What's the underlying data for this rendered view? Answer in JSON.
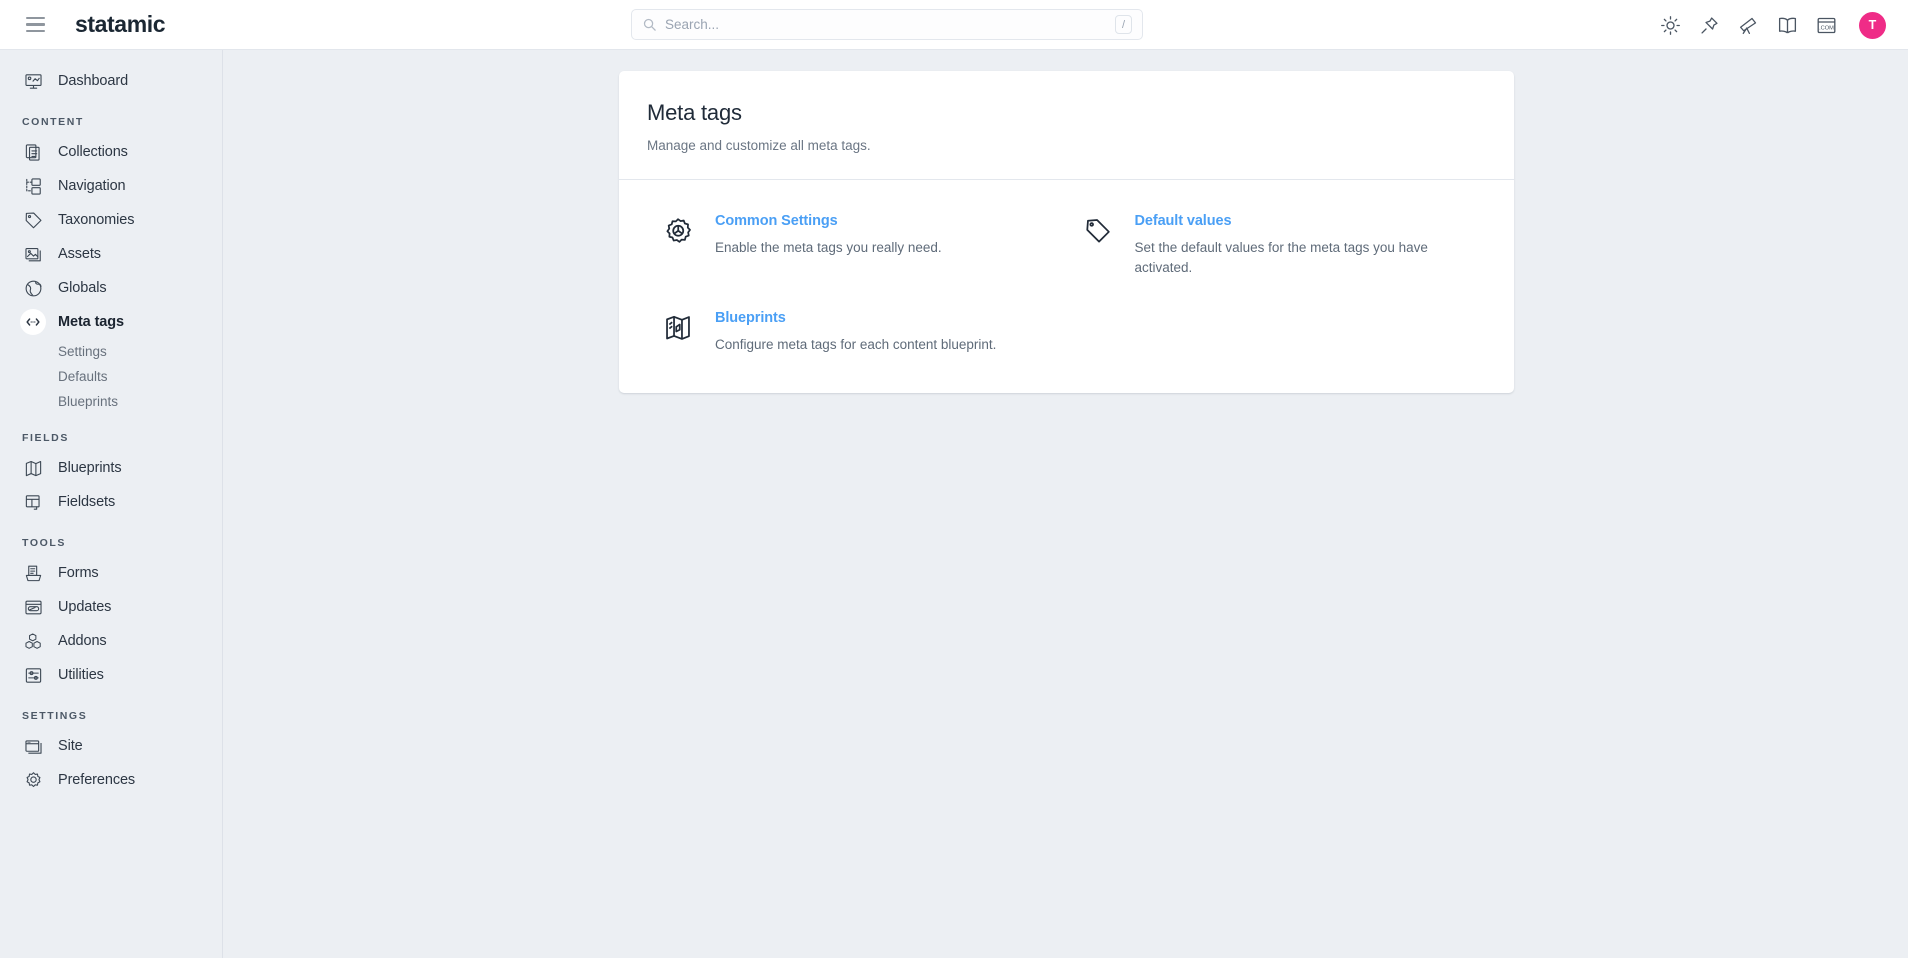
{
  "topbar": {
    "menu_icon": "hamburger-icon",
    "brand": "statamic",
    "search": {
      "placeholder": "Search...",
      "value": "",
      "shortcut": "/",
      "icon": "search-icon"
    },
    "icons": [
      {
        "name": "sun-icon",
        "title": "Light mode"
      },
      {
        "name": "pin-icon",
        "title": "Pinned"
      },
      {
        "name": "telescope-icon",
        "title": "Explore"
      },
      {
        "name": "book-icon",
        "title": "Documentation"
      },
      {
        "name": "dotcom-icon",
        "title": "Visit site"
      }
    ],
    "avatar": {
      "initial": "T",
      "color": "#ef2c87"
    }
  },
  "sidebar": {
    "top": [
      {
        "label": "Dashboard",
        "icon": "dashboard-icon",
        "active": false
      }
    ],
    "sections": [
      {
        "title": "CONTENT",
        "items": [
          {
            "label": "Collections",
            "icon": "collections-icon",
            "active": false
          },
          {
            "label": "Navigation",
            "icon": "navigation-icon",
            "active": false
          },
          {
            "label": "Taxonomies",
            "icon": "taxonomies-icon",
            "active": false
          },
          {
            "label": "Assets",
            "icon": "assets-icon",
            "active": false
          },
          {
            "label": "Globals",
            "icon": "globals-icon",
            "active": false
          },
          {
            "label": "Meta tags",
            "icon": "meta-tags-icon",
            "active": true,
            "children": [
              {
                "label": "Settings"
              },
              {
                "label": "Defaults"
              },
              {
                "label": "Blueprints"
              }
            ]
          }
        ]
      },
      {
        "title": "FIELDS",
        "items": [
          {
            "label": "Blueprints",
            "icon": "blueprints-icon",
            "active": false
          },
          {
            "label": "Fieldsets",
            "icon": "fieldsets-icon",
            "active": false
          }
        ]
      },
      {
        "title": "TOOLS",
        "items": [
          {
            "label": "Forms",
            "icon": "forms-icon",
            "active": false
          },
          {
            "label": "Updates",
            "icon": "updates-icon",
            "active": false
          },
          {
            "label": "Addons",
            "icon": "addons-icon",
            "active": false
          },
          {
            "label": "Utilities",
            "icon": "utilities-icon",
            "active": false
          }
        ]
      },
      {
        "title": "SETTINGS",
        "items": [
          {
            "label": "Site",
            "icon": "site-icon",
            "active": false
          },
          {
            "label": "Preferences",
            "icon": "preferences-icon",
            "active": false
          }
        ]
      }
    ]
  },
  "main": {
    "card": {
      "title": "Meta tags",
      "subtitle": "Manage and customize all meta tags.",
      "features": [
        {
          "icon": "gear-icon",
          "link": "Common Settings",
          "desc": "Enable the meta tags you really need."
        },
        {
          "icon": "tag-icon",
          "link": "Default values",
          "desc": "Set the default values for the meta tags you have activated."
        },
        {
          "icon": "map-icon",
          "link": "Blueprints",
          "desc": "Configure meta tags for each content blueprint."
        }
      ]
    }
  },
  "colors": {
    "accent_link": "#4a9ff5",
    "avatar": "#ef2c87",
    "background": "#eceff3",
    "card": "#ffffff"
  }
}
